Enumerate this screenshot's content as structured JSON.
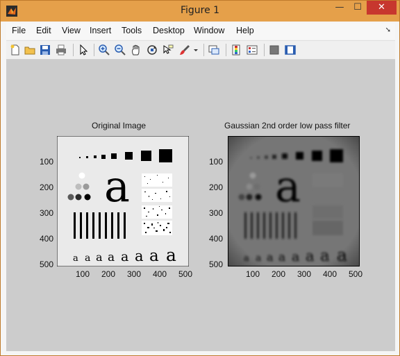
{
  "window": {
    "title": "Figure 1",
    "close_glyph": "✕",
    "minimize_glyph": "—",
    "maximize_glyph": "☐"
  },
  "menu": [
    "File",
    "Edit",
    "View",
    "Insert",
    "Tools",
    "Desktop",
    "Window",
    "Help"
  ],
  "toolbar_icons": [
    "new-figure-icon",
    "open-file-icon",
    "save-icon",
    "print-icon",
    "pointer-icon",
    "zoom-in-icon",
    "zoom-out-icon",
    "pan-icon",
    "rotate-3d-icon",
    "data-cursor-icon",
    "brush-icon",
    "brush-dropdown-icon",
    "link-plot-icon",
    "colorbar-icon",
    "legend-icon",
    "hide-plot-tools-icon",
    "show-plot-tools-icon"
  ],
  "plots": [
    {
      "title": "Original Image",
      "yticks": [
        "100",
        "200",
        "300",
        "400",
        "500"
      ],
      "xticks": [
        "100",
        "200",
        "300",
        "400",
        "500"
      ]
    },
    {
      "title": "Gaussian 2nd order low pass filter",
      "yticks": [
        "100",
        "200",
        "300",
        "400",
        "500"
      ],
      "xticks": [
        "100",
        "200",
        "300",
        "400",
        "500"
      ]
    }
  ],
  "glyph": "a",
  "colors": {
    "titlebar": "#e5a04a",
    "close": "#c7372e",
    "canvas": "#cccccc"
  }
}
